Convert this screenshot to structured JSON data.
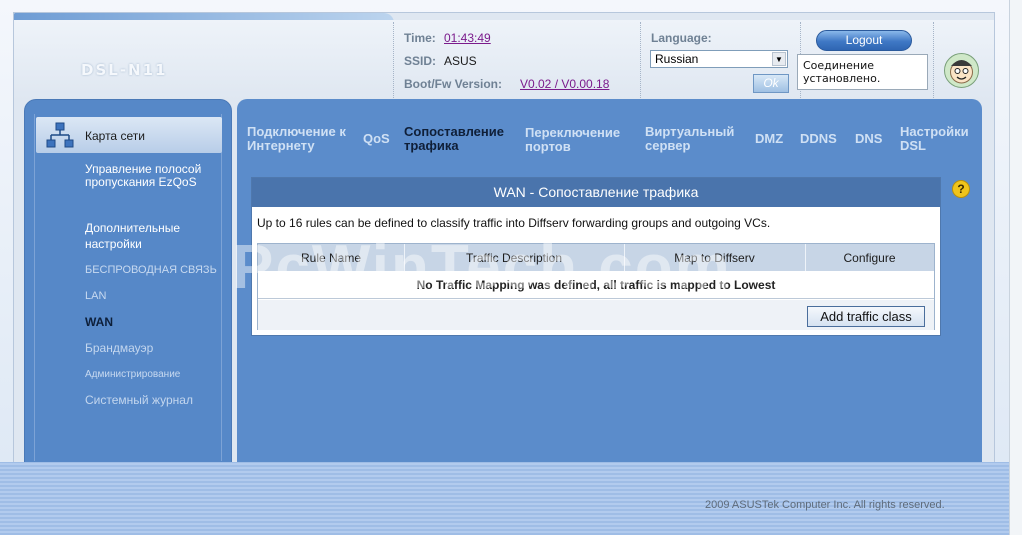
{
  "header": {
    "model": "DSL-N11",
    "time_label": "Time:",
    "time_value": "01:43:49",
    "ssid_label": "SSID:",
    "ssid_value": "ASUS",
    "fw_label": "Boot/Fw Version:",
    "fw_value": "V0.02 / V0.00.18",
    "language_label": "Language:",
    "language_selected": "Russian",
    "ok_label": "Ok",
    "logout_label": "Logout",
    "status_text": "Соединение установлено."
  },
  "sidebar": {
    "active_item": "Карта сети",
    "items": [
      {
        "label": "Управление полосой пропускания EzQoS"
      },
      {
        "label": "Дополнительные настройки"
      },
      {
        "label": "БЕСПРОВОДНАЯ СВЯЗЬ"
      },
      {
        "label": "LAN"
      },
      {
        "label": "WAN"
      },
      {
        "label": "Брандмауэр"
      },
      {
        "label": "Администрирование"
      },
      {
        "label": "Системный журнал"
      }
    ]
  },
  "tabs": [
    {
      "label": "Подключение к Интернету"
    },
    {
      "label": "QoS"
    },
    {
      "label": "Сопоставление трафика",
      "active": true
    },
    {
      "label": "Переключение портов"
    },
    {
      "label": "Виртуальный сервер"
    },
    {
      "label": "DMZ"
    },
    {
      "label": "DDNS"
    },
    {
      "label": "DNS"
    },
    {
      "label": "Настройки DSL"
    }
  ],
  "content": {
    "title": "WAN - Сопоставление трафика",
    "description": "Up to 16 rules can be defined to classify traffic into Diffserv forwarding groups and outgoing VCs.",
    "table": {
      "headers": [
        "Rule Name",
        "Traffic Description",
        "Map to Diffserv",
        "Configure"
      ],
      "empty_message": "No Traffic Mapping was defined, all traffic is mapped to Lowest"
    },
    "add_button": "Add traffic class",
    "help_icon": "?"
  },
  "watermark": "PcWinTech.com",
  "footer": {
    "copyright": "2009 ASUSTek Computer Inc. All rights reserved."
  }
}
